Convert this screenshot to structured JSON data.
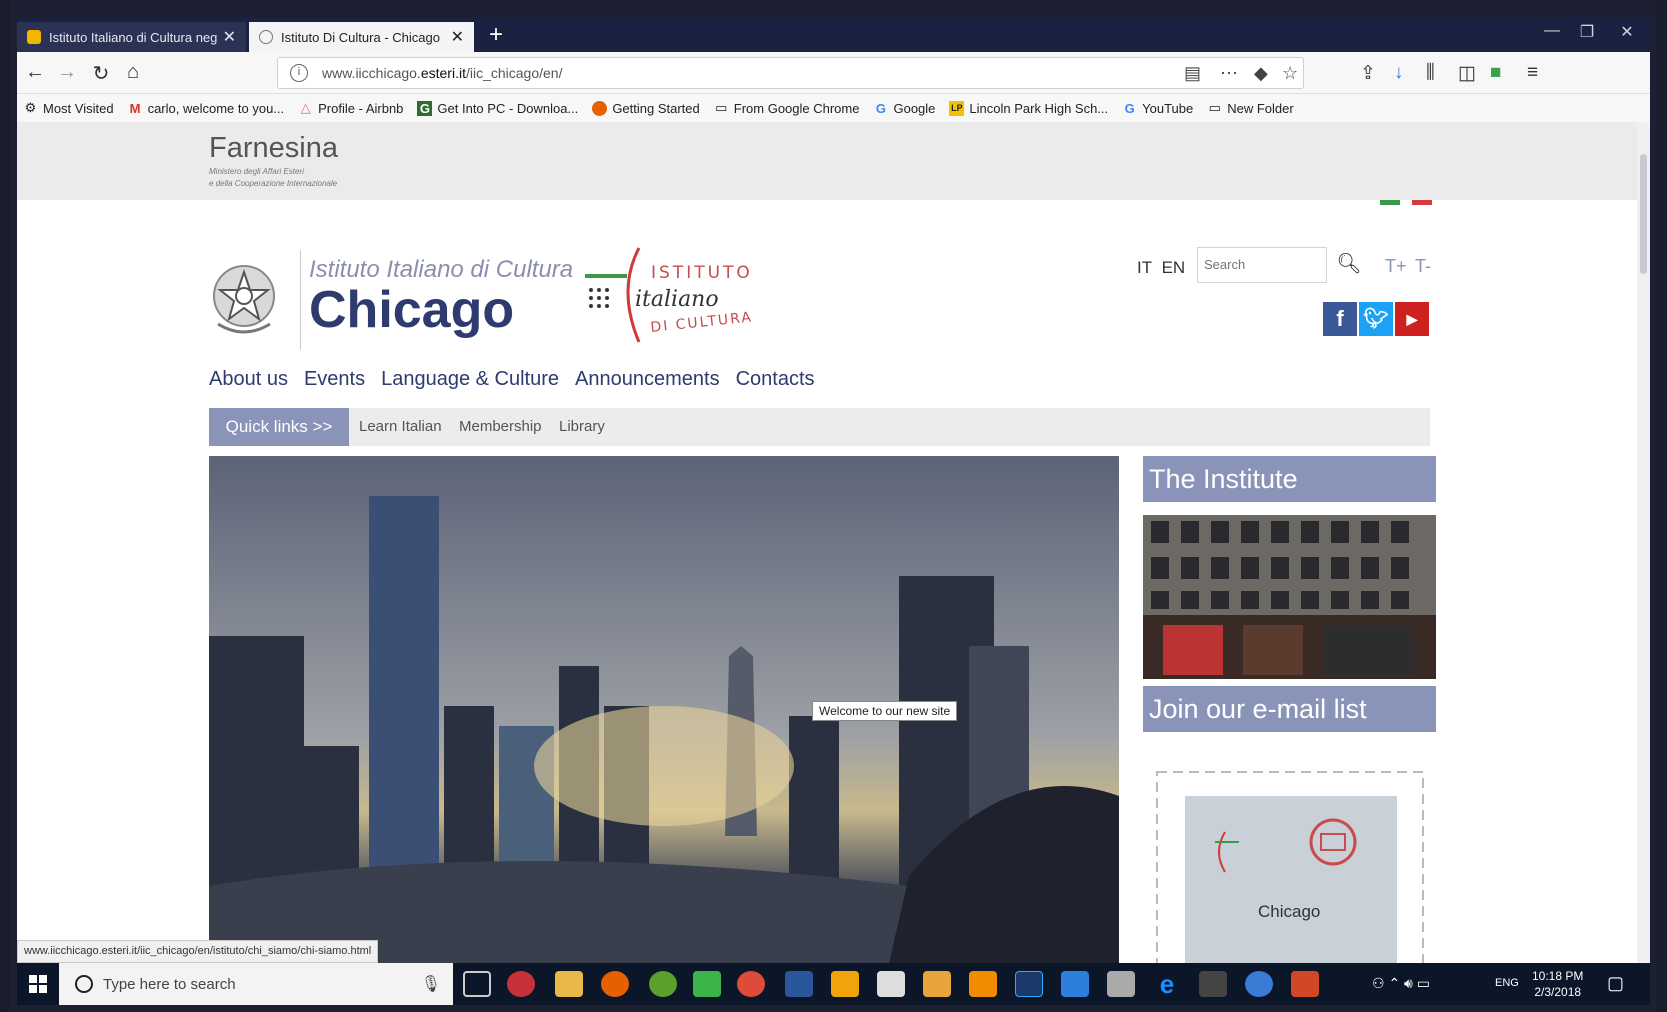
{
  "browser": {
    "tabs": [
      {
        "title": "Istituto Italiano di Cultura neg",
        "active": false
      },
      {
        "title": "Istituto Di Cultura - Chicago",
        "active": true
      }
    ],
    "url_prefix": "www.iicchicago.",
    "url_domain": "esteri.it",
    "url_suffix": "/iic_chicago/en/",
    "bookmarks": [
      "Most Visited",
      "carlo, welcome to you...",
      "Profile - Airbnb",
      "Get Into PC - Downloa...",
      "Getting Started",
      "From Google Chrome",
      "Google",
      "Lincoln Park High Sch...",
      "YouTube",
      "New Folder"
    ],
    "status_url": "www.iicchicago.esteri.it/iic_chicago/en/istituto/chi_siamo/chi-siamo.html"
  },
  "site": {
    "ministry_name": "Farnesina",
    "ministry_sub1": "Ministero degli Affari Esteri",
    "ministry_sub2": "e della Cooperazione Internazionale",
    "institute_name": "Istituto Italiano di Cultura",
    "city": "Chicago",
    "logo_line1": "ISTITUTO",
    "logo_line2": "italiano",
    "logo_line3": "DI CULTURA",
    "lang_it": "IT",
    "lang_en": "EN",
    "search_placeholder": "Search",
    "text_increase": "T+",
    "text_decrease": "T-",
    "nav": [
      "About us",
      "Events",
      "Language & Culture",
      "Announcements",
      "Contacts"
    ],
    "quicklinks_label": "Quick links >>",
    "quicklinks": [
      "Learn Italian",
      "Membership",
      "Library"
    ],
    "hero_tooltip": "Welcome to our new site",
    "side_institute": "The Institute",
    "side_email": "Join our e-mail list",
    "stamp_city": "Chicago"
  },
  "taskbar": {
    "search_placeholder": "Type here to search",
    "lang": "ENG",
    "time": "10:18 PM",
    "date": "2/3/2018"
  },
  "colors": {
    "brand_blue": "#2d3b6f",
    "accent_lavender": "#8a94b8",
    "facebook": "#3b5998",
    "twitter": "#1da1f2",
    "youtube": "#cd201f"
  }
}
